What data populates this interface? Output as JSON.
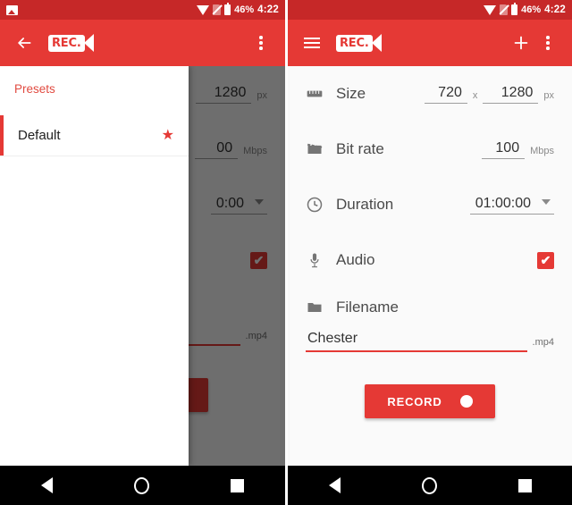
{
  "status_bar": {
    "notification_icon": "image-icon",
    "wifi_icon": "wifi-icon",
    "sim_icon": "no-sim-icon",
    "battery_icon": "battery-icon",
    "battery_pct": "46%",
    "time": "4:22"
  },
  "colors": {
    "accent": "#e53935",
    "status_bar": "#c62828",
    "scrim": "rgba(0,0,0,0.56)",
    "page_bg": "#fafafa"
  },
  "left_screen": {
    "appbar": {
      "nav_icon": "back-arrow-icon",
      "logo_text": "REC.",
      "overflow_icon": "more-vert-icon"
    },
    "drawer": {
      "title": "Presets",
      "items": [
        {
          "label": "Default",
          "starred_icon": "star-icon",
          "selected": true
        }
      ]
    },
    "background_hints": {
      "size_height": "1280",
      "size_unit": "px",
      "bitrate_value": "00",
      "bitrate_unit": "Mbps",
      "duration_value": "0:00",
      "filename_ext": ".mp4"
    }
  },
  "right_screen": {
    "appbar": {
      "nav_icon": "hamburger-icon",
      "logo_text": "REC.",
      "add_icon": "plus-icon",
      "overflow_icon": "more-vert-icon"
    },
    "rows": [
      {
        "id": "size",
        "icon": "ruler-icon",
        "label": "Size",
        "width": "720",
        "separator": "x",
        "height": "1280",
        "unit": "px"
      },
      {
        "id": "bitrate",
        "icon": "clapperboard-icon",
        "label": "Bit rate",
        "value": "100",
        "unit": "Mbps"
      },
      {
        "id": "duration",
        "icon": "clock-icon",
        "label": "Duration",
        "value": "01:00:00",
        "caret": "chevron-down-icon"
      },
      {
        "id": "audio",
        "icon": "microphone-icon",
        "label": "Audio",
        "checked": true,
        "check_glyph": "✔"
      }
    ],
    "filename": {
      "icon": "folder-icon",
      "label": "Filename",
      "value": "Chester",
      "placeholder": "Filename",
      "extension": ".mp4"
    },
    "record_button": {
      "label": "RECORD",
      "dot_icon": "record-dot-icon"
    }
  },
  "nav_bar": {
    "back": "back-triangle-icon",
    "home": "home-circle-icon",
    "recents": "recents-square-icon"
  }
}
